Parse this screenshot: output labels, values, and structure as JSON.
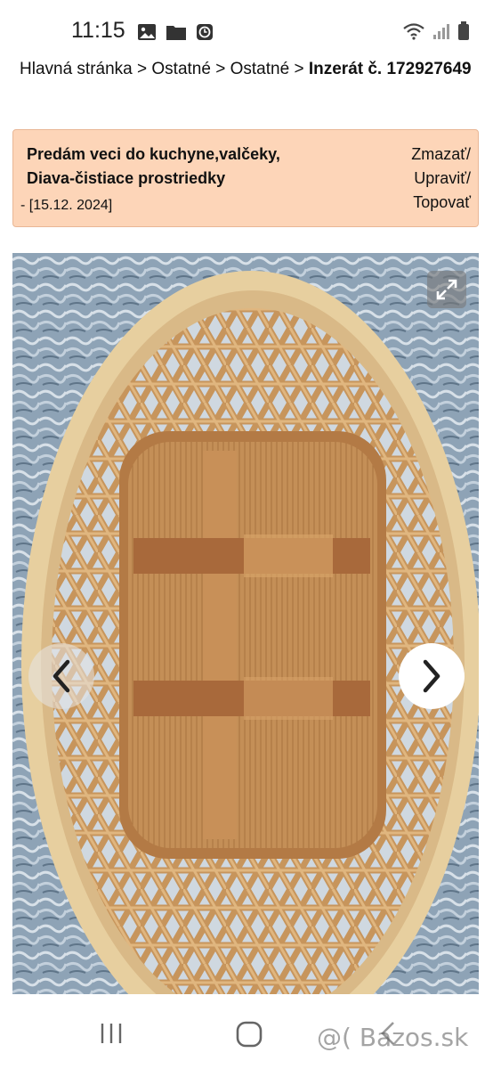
{
  "status_bar": {
    "time": "11:15",
    "left_icons": [
      "gallery-icon",
      "folder-icon",
      "clock-app-icon"
    ],
    "right_icons": [
      "wifi-icon",
      "signal-icon",
      "battery-icon"
    ]
  },
  "breadcrumb": {
    "items": [
      "Hlavná stránka",
      "Ostatné",
      "Ostatné"
    ],
    "separator": ">",
    "current": "Inzerát č. 172927649"
  },
  "listing": {
    "title_line1": "Predám veci do kuchyne,valčeky,",
    "title_line2": "Diava-čistiace prostriedky",
    "date": "- [15.12. 2024]",
    "actions": [
      "Zmazať/",
      "Upraviť/",
      "Topovať"
    ],
    "box_color": "#fdd5b8"
  },
  "gallery": {
    "image_subject": "woven-basket-photo",
    "expand_icon": "expand-icon",
    "prev_icon": "chevron-left-icon",
    "next_icon": "chevron-right-icon"
  },
  "system_nav": {
    "icons": [
      "recent-apps-icon",
      "home-icon",
      "back-icon"
    ]
  },
  "watermark": "@( Bazos.sk"
}
